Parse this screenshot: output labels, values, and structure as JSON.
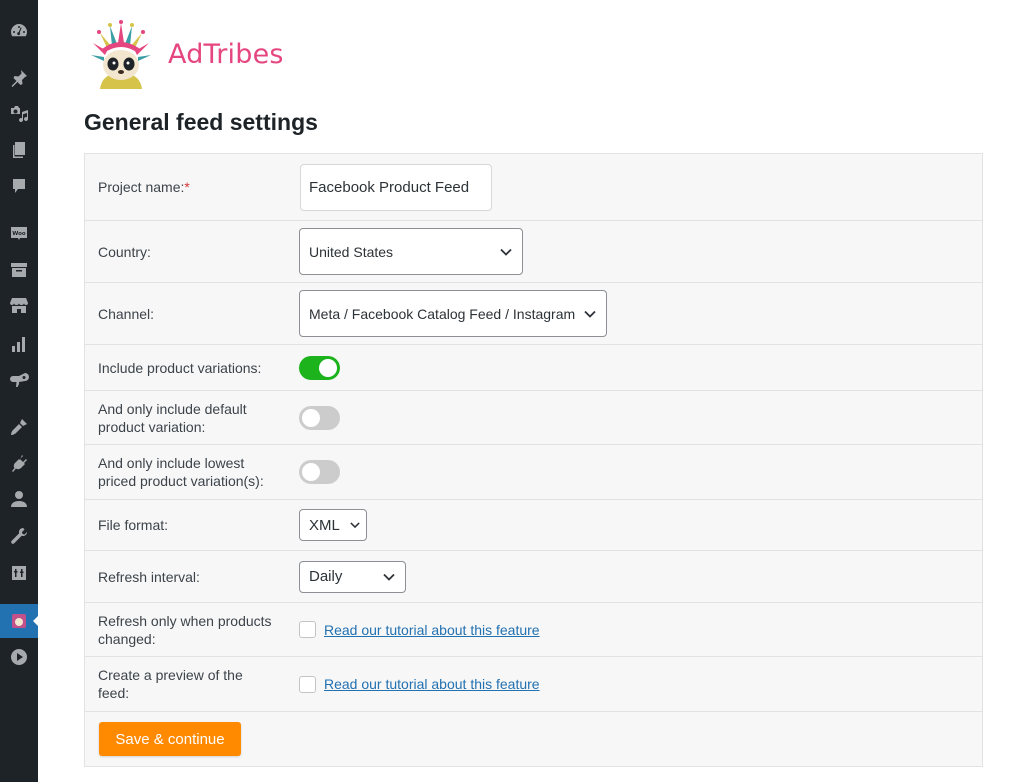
{
  "admin_menu": {
    "items": [
      {
        "icon": "dashboard-icon"
      },
      {
        "icon": "pin-icon"
      },
      {
        "icon": "media-icon"
      },
      {
        "icon": "pages-icon"
      },
      {
        "icon": "comments-icon"
      },
      {
        "icon": "woocommerce-icon",
        "label": "Woo"
      },
      {
        "icon": "archive-icon"
      },
      {
        "icon": "store-icon"
      },
      {
        "icon": "analytics-icon"
      },
      {
        "icon": "marketing-icon"
      },
      {
        "icon": "appearance-icon"
      },
      {
        "icon": "plugins-icon"
      },
      {
        "icon": "users-icon"
      },
      {
        "icon": "tools-icon"
      },
      {
        "icon": "settings-icon"
      },
      {
        "icon": "adtribes-icon",
        "active": true
      },
      {
        "icon": "play-icon"
      }
    ],
    "active_color": "#2271b1"
  },
  "brand": {
    "name": "AdTribes",
    "color": "#e5467f"
  },
  "page": {
    "title": "General feed settings"
  },
  "form": {
    "project_name": {
      "label": "Project name:",
      "required_mark": "*",
      "value": "Facebook Product Feed"
    },
    "country": {
      "label": "Country:",
      "selected": "United States"
    },
    "channel": {
      "label": "Channel:",
      "selected": "Meta / Facebook Catalog Feed / Instagram"
    },
    "include_variations": {
      "label": "Include product variations:",
      "checked": true
    },
    "default_variation": {
      "label": "And only include default product variation:",
      "checked": false
    },
    "lowest_priced_variation": {
      "label": "And only include lowest priced product variation(s):",
      "checked": false
    },
    "file_format": {
      "label": "File format:",
      "selected": "XML"
    },
    "refresh_interval": {
      "label": "Refresh interval:",
      "selected": "Daily"
    },
    "refresh_only_changed": {
      "label": "Refresh only when products changed:",
      "checked": false,
      "link_text": "Read our tutorial about this feature"
    },
    "create_preview": {
      "label": "Create a preview of the feed:",
      "checked": false,
      "link_text": "Read our tutorial about this feature"
    },
    "submit": {
      "label": "Save & continue",
      "color": "#ff8a00"
    }
  },
  "colors": {
    "toggle_on": "#1db31d",
    "toggle_off": "#cccccc",
    "link": "#2271b1"
  }
}
